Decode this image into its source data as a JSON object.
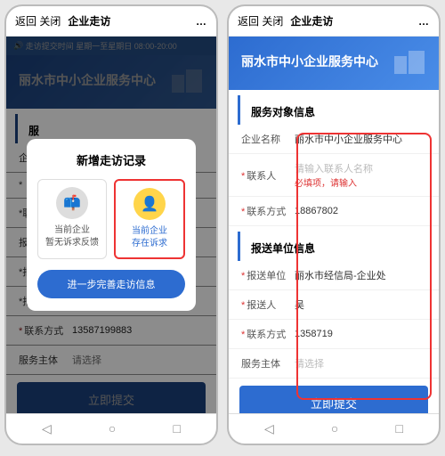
{
  "nav": {
    "back": "返回",
    "close": "关闭",
    "title": "企业走访",
    "more": "…"
  },
  "notice": "走访提交时间  星期一至星期日  08:00-20:00",
  "hero_title": "丽水市中小企业服务中心",
  "modal": {
    "title": "新增走访记录",
    "card_no_demand_l1": "当前企业",
    "card_no_demand_l2": "暂无诉求反馈",
    "card_has_demand_l1": "当前企业",
    "card_has_demand_l2": "存在诉求",
    "btn": "进一步完善走访信息"
  },
  "left_form": {
    "contact_label": "联系方式",
    "contact_value": "13587199883",
    "svc_label": "服务主体",
    "svc_placeholder": "请选择"
  },
  "s1": {
    "title": "服务对象信息",
    "name_label": "企业名称",
    "name_value": "丽水市中小企业服务中心",
    "contact_label": "联系人",
    "contact_ph": "请输入联系人名称",
    "contact_err": "必填项，请输入",
    "phone_label": "联系方式",
    "phone_value": "18867802"
  },
  "s2": {
    "title": "报送单位信息",
    "unit_label": "报送单位",
    "unit_value": "丽水市经信局-企业处",
    "person_label": "报送人",
    "person_value": "吴",
    "phone_label": "联系方式",
    "phone_value": "1358719",
    "svc_label": "服务主体",
    "svc_ph": "请选择"
  },
  "submit": "立即提交",
  "icons": {
    "speaker": "🔊",
    "mailbox": "📫",
    "person": "👤",
    "tri": "◁",
    "circ": "○",
    "sq": "□"
  }
}
